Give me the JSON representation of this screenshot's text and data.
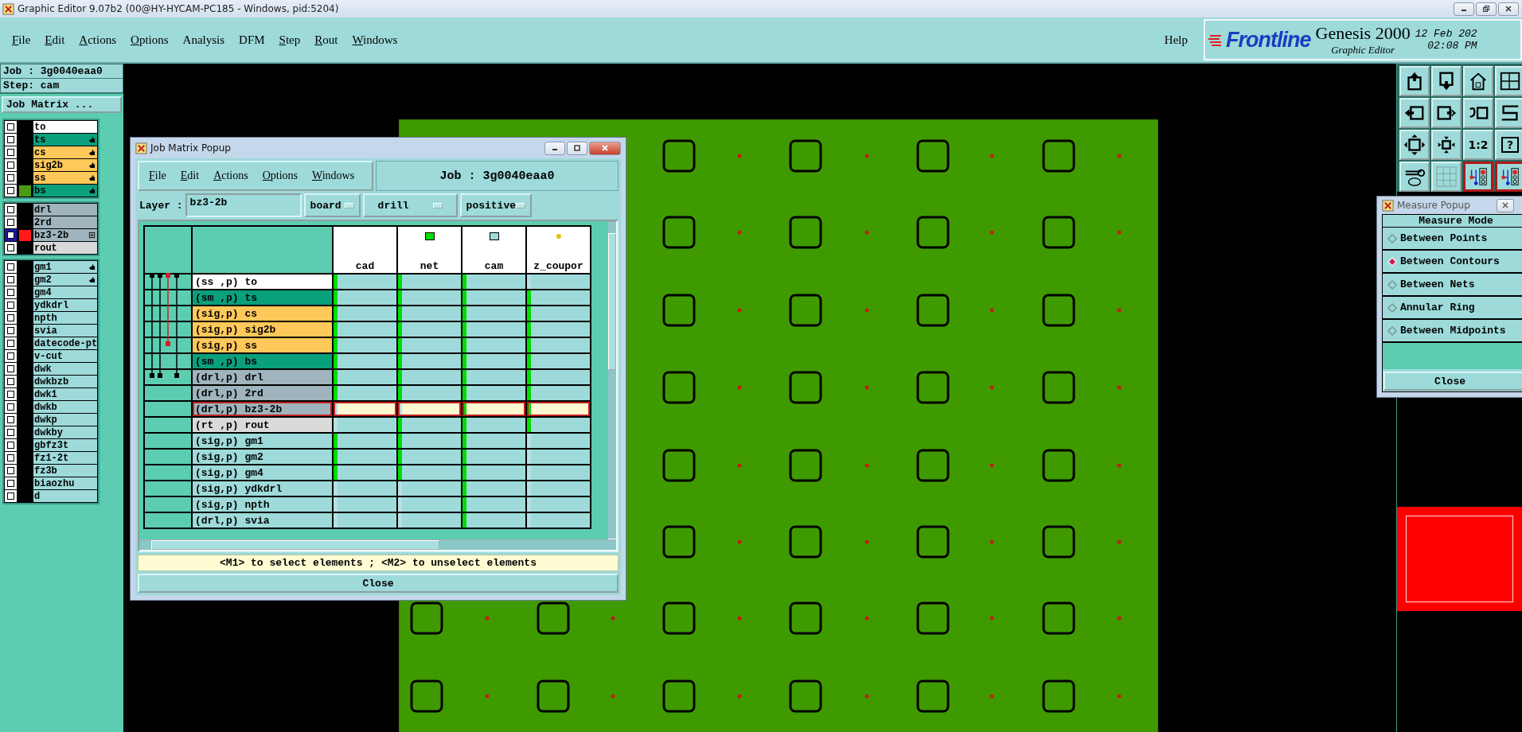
{
  "window": {
    "title": "Graphic Editor 9.07b2 (00@HY-HYCAM-PC185 - Windows, pid:5204)"
  },
  "menu": [
    {
      "label": "File",
      "underlined": true
    },
    {
      "label": "Edit",
      "underlined": true
    },
    {
      "label": "Actions",
      "underlined": true
    },
    {
      "label": "Options",
      "underlined": true
    },
    {
      "label": "Analysis",
      "underlined": false
    },
    {
      "label": "DFM",
      "underlined": false
    },
    {
      "label": "Step",
      "underlined": true
    },
    {
      "label": "Rout",
      "underlined": true
    },
    {
      "label": "Windows",
      "underlined": true
    }
  ],
  "help": "Help",
  "brand": {
    "logo": "Frontline",
    "product": "Genesis 2000",
    "subtitle": "Graphic Editor",
    "date": "12 Feb 202",
    "time": "02:08 PM"
  },
  "job_info": {
    "job": "Job : 3g0040eaa0",
    "step": "Step: cam",
    "matrix_button": "Job Matrix ..."
  },
  "layer_groups": [
    [
      {
        "name": "to",
        "color": "#ffffff",
        "checked": false,
        "affected": false,
        "work": false
      },
      {
        "name": "ts",
        "color": "#0aa07c",
        "checked": false,
        "affected": true,
        "work": false
      },
      {
        "name": "cs",
        "color": "#ffc85a",
        "checked": false,
        "affected": true,
        "work": false
      },
      {
        "name": "sig2b",
        "color": "#ffc85a",
        "checked": false,
        "affected": true,
        "work": false
      },
      {
        "name": "ss",
        "color": "#ffc85a",
        "checked": false,
        "affected": true,
        "work": false
      },
      {
        "name": "bs",
        "color": "#0aa07c",
        "swatch": {
          "color": "#4a9a12"
        },
        "checked": false,
        "affected": true,
        "work": false
      }
    ],
    [
      {
        "name": "drl",
        "color": "#9fb4bc",
        "checked": false,
        "affected": false,
        "work": false
      },
      {
        "name": "2rd",
        "color": "#9fb4bc",
        "checked": false,
        "affected": false,
        "work": false
      },
      {
        "name": "bz3-2b",
        "color": "#9fb4bc",
        "swatch": {
          "color": "#ff1a1a"
        },
        "checked": false,
        "affected": false,
        "work": true
      },
      {
        "name": "rout",
        "color": "#dadada",
        "checked": false,
        "affected": false,
        "work": false
      }
    ],
    [
      {
        "name": "gm1",
        "color": "#9edada",
        "checked": false,
        "affected": true,
        "work": false
      },
      {
        "name": "gm2",
        "color": "#9edada",
        "checked": false,
        "affected": true,
        "work": false
      },
      {
        "name": "gm4",
        "color": "#9edada",
        "checked": false,
        "affected": false,
        "work": false
      },
      {
        "name": "ydkdrl",
        "color": "#9edada",
        "checked": false,
        "affected": false,
        "work": false
      },
      {
        "name": "npth",
        "color": "#9edada",
        "checked": false,
        "affected": false,
        "work": false
      },
      {
        "name": "svia",
        "color": "#9edada",
        "checked": false,
        "affected": false,
        "work": false
      },
      {
        "name": "datecode-pt",
        "color": "#9edada",
        "checked": false,
        "affected": false,
        "work": false
      },
      {
        "name": "v-cut",
        "color": "#9edada",
        "checked": false,
        "affected": false,
        "work": false
      },
      {
        "name": "dwk",
        "color": "#9edada",
        "checked": false,
        "affected": false,
        "work": false
      },
      {
        "name": "dwkbzb",
        "color": "#9edada",
        "checked": false,
        "affected": false,
        "work": false
      },
      {
        "name": "dwk1",
        "color": "#9edada",
        "checked": false,
        "affected": false,
        "work": false
      },
      {
        "name": "dwkb",
        "color": "#9edada",
        "checked": false,
        "affected": false,
        "work": false
      },
      {
        "name": "dwkp",
        "color": "#9edada",
        "checked": false,
        "affected": false,
        "work": false
      },
      {
        "name": "dwkby",
        "color": "#9edada",
        "checked": false,
        "affected": false,
        "work": false
      },
      {
        "name": "gbfz3t",
        "color": "#9edada",
        "checked": false,
        "affected": false,
        "work": false
      },
      {
        "name": "fz1-2t",
        "color": "#9edada",
        "checked": false,
        "affected": false,
        "work": false
      },
      {
        "name": "fz3b",
        "color": "#9edada",
        "checked": false,
        "affected": false,
        "work": false
      },
      {
        "name": "biaozhu",
        "color": "#9edada",
        "checked": false,
        "affected": false,
        "work": false
      },
      {
        "name": "d",
        "color": "#9edada",
        "checked": false,
        "affected": false,
        "work": false
      }
    ]
  ],
  "toolbar": [
    {
      "kind": "icon",
      "active": false
    },
    {
      "kind": "icon",
      "active": false
    },
    {
      "kind": "icon",
      "active": false
    },
    {
      "kind": "icon",
      "active": false
    },
    {
      "kind": "icon",
      "active": false
    },
    {
      "kind": "icon",
      "active": false
    },
    {
      "kind": "icon",
      "active": false
    },
    {
      "kind": "icon",
      "active": false
    },
    {
      "kind": "icon",
      "active": false
    },
    {
      "kind": "icon",
      "active": false
    },
    {
      "kind": "text",
      "label": "1:2",
      "active": false
    },
    {
      "kind": "text",
      "label": "?",
      "active": false
    },
    {
      "kind": "icon",
      "active": false
    },
    {
      "kind": "icon",
      "active": false
    },
    {
      "kind": "icon",
      "active": true
    },
    {
      "kind": "icon",
      "active": true
    }
  ],
  "job_matrix": {
    "title": "Job Matrix Popup",
    "menu": [
      {
        "label": "File"
      },
      {
        "label": "Edit"
      },
      {
        "label": "Actions"
      },
      {
        "label": "Options"
      },
      {
        "label": "Windows"
      }
    ],
    "job_label": "Job : 3g0040eaa0",
    "layer_label": "Layer :",
    "layer_value": "bz3-2b",
    "context": "board",
    "type": "drill",
    "polarity": "positive",
    "columns": [
      {
        "name": "cad",
        "kind": "plain"
      },
      {
        "name": "net",
        "kind": "square",
        "color": "#00e000"
      },
      {
        "name": "cam",
        "kind": "square",
        "color": "#a0dcdc"
      },
      {
        "name": "z_coupor",
        "kind": "dot",
        "color": "#e0c000"
      }
    ],
    "rows": [
      {
        "label": "(ss ,p) to",
        "color": "#ffffff",
        "selected": false,
        "cells": [
          true,
          true,
          true,
          false
        ]
      },
      {
        "label": "(sm ,p) ts",
        "color": "#0aa07c",
        "selected": false,
        "cells": [
          true,
          true,
          true,
          true
        ]
      },
      {
        "label": "(sig,p) cs",
        "color": "#ffc85a",
        "selected": false,
        "cells": [
          true,
          true,
          true,
          true
        ]
      },
      {
        "label": "(sig,p) sig2b",
        "color": "#ffc85a",
        "selected": false,
        "cells": [
          true,
          true,
          true,
          true
        ]
      },
      {
        "label": "(sig,p) ss",
        "color": "#ffc85a",
        "selected": false,
        "cells": [
          true,
          true,
          true,
          true
        ]
      },
      {
        "label": "(sm ,p) bs",
        "color": "#0aa07c",
        "selected": false,
        "cells": [
          true,
          true,
          true,
          true
        ]
      },
      {
        "label": "(drl,p) drl",
        "color": "#9fb4bc",
        "selected": false,
        "cells": [
          true,
          true,
          true,
          true
        ]
      },
      {
        "label": "(drl,p) 2rd",
        "color": "#9fb4bc",
        "selected": false,
        "cells": [
          true,
          true,
          true,
          true
        ]
      },
      {
        "label": "(drl,p) bz3-2b",
        "color": "#9fb4bc",
        "selected": true,
        "cells": [
          false,
          false,
          true,
          true
        ]
      },
      {
        "label": "(rt ,p) rout",
        "color": "#dadada",
        "selected": false,
        "cells": [
          false,
          true,
          true,
          true
        ]
      },
      {
        "label": "(sig,p) gm1",
        "color": "#9edada",
        "selected": false,
        "cells": [
          true,
          true,
          true,
          false
        ]
      },
      {
        "label": "(sig,p) gm2",
        "color": "#9edada",
        "selected": false,
        "cells": [
          true,
          true,
          true,
          false
        ]
      },
      {
        "label": "(sig,p) gm4",
        "color": "#9edada",
        "selected": false,
        "cells": [
          true,
          true,
          true,
          false
        ]
      },
      {
        "label": "(sig,p) ydkdrl",
        "color": "#9edada",
        "selected": false,
        "cells": [
          false,
          false,
          true,
          false
        ]
      },
      {
        "label": "(sig,p) npth",
        "color": "#9edada",
        "selected": false,
        "cells": [
          false,
          false,
          true,
          false
        ]
      },
      {
        "label": "(drl,p) svia",
        "color": "#9edada",
        "selected": false,
        "cells": [
          false,
          false,
          true,
          false
        ]
      }
    ],
    "hint": "<M1> to select elements ; <M2> to unselect elements",
    "close": "Close"
  },
  "measure": {
    "title": "Measure Popup",
    "heading": "Measure Mode",
    "options": [
      {
        "label": "Between Points",
        "selected": false
      },
      {
        "label": "Between Contours",
        "selected": true
      },
      {
        "label": "Between Nets",
        "selected": false
      },
      {
        "label": "Annular Ring",
        "selected": false
      },
      {
        "label": "Between Midpoints",
        "selected": false
      }
    ],
    "close": "Close"
  }
}
